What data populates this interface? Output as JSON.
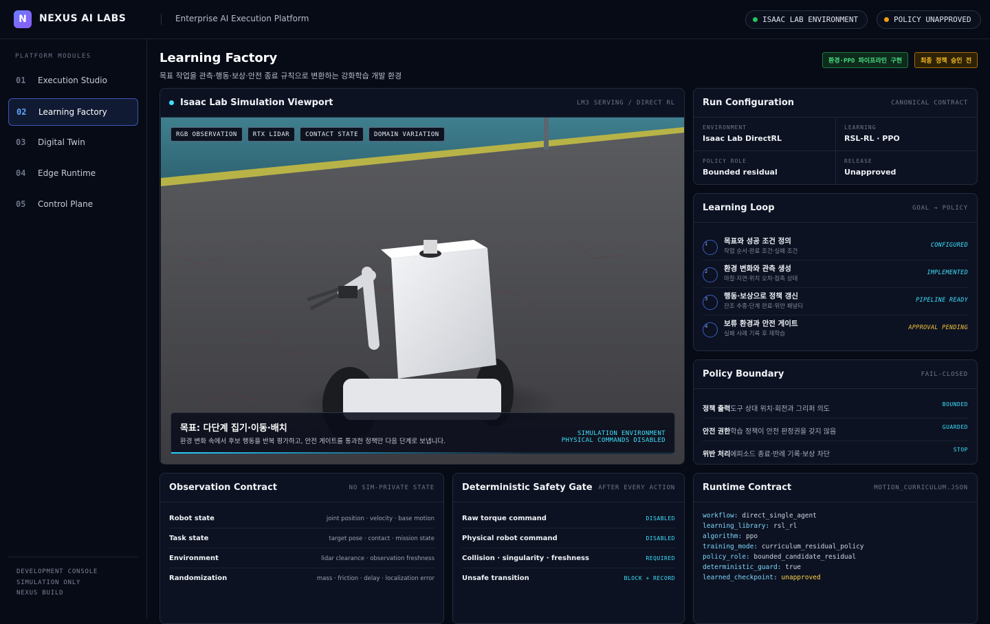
{
  "header": {
    "logo_letter": "N",
    "brand": "NEXUS AI LABS",
    "subtitle": "Enterprise AI Execution Platform",
    "status_pills": [
      {
        "label": "ISAAC LAB ENVIRONMENT",
        "color": "#22c55e"
      },
      {
        "label": "POLICY UNAPPROVED",
        "color": "#f59e0b"
      }
    ]
  },
  "sidebar": {
    "heading": "PLATFORM MODULES",
    "items": [
      {
        "num": "01",
        "label": "Execution Studio",
        "active": false
      },
      {
        "num": "02",
        "label": "Learning Factory",
        "active": true
      },
      {
        "num": "03",
        "label": "Digital Twin",
        "active": false
      },
      {
        "num": "04",
        "label": "Edge Runtime",
        "active": false
      },
      {
        "num": "05",
        "label": "Control Plane",
        "active": false
      }
    ],
    "footer": [
      "DEVELOPMENT CONSOLE",
      "SIMULATION ONLY",
      "NEXUS BUILD"
    ]
  },
  "page": {
    "title": "Learning Factory",
    "subtitle": "목표 작업을 관측·행동·보상·안전 종료 규칙으로 변환하는 강화학습 개발 환경",
    "badges": [
      {
        "label": "환경·PPO 파이프라인 구현",
        "color": "#22c55e"
      },
      {
        "label": "최종 정책 승인 전",
        "color": "#f59e0b"
      }
    ]
  },
  "viewport": {
    "title": "Isaac Lab Simulation Viewport",
    "meta": "LM3 SERVING / DIRECT RL",
    "tags": [
      "RGB OBSERVATION",
      "RTX LIDAR",
      "CONTACT STATE",
      "DOMAIN VARIATION"
    ],
    "goal_title": "목표: 다단계 집기·이동·배치",
    "goal_desc": "환경 변화 속에서 후보 행동을 반복 평가하고, 안전 게이트를 통과한 정책만 다음 단계로 보냅니다.",
    "goal_status_1": "SIMULATION ENVIRONMENT",
    "goal_status_2": "PHYSICAL COMMANDS DISABLED"
  },
  "run_config": {
    "title": "Run Configuration",
    "meta": "CANONICAL CONTRACT",
    "cells": [
      {
        "key": "ENVIRONMENT",
        "value": "Isaac Lab DirectRL"
      },
      {
        "key": "LEARNING",
        "value": "RSL-RL · PPO"
      },
      {
        "key": "POLICY ROLE",
        "value": "Bounded residual"
      },
      {
        "key": "RELEASE",
        "value": "Unapproved"
      }
    ]
  },
  "learning_loop": {
    "title": "Learning Loop",
    "meta": "GOAL → POLICY",
    "steps": [
      {
        "n": "1",
        "title": "목표와 성공 조건 정의",
        "desc": "작업 순서·완료 조건·실패 조건",
        "status": "CONFIGURED",
        "color": "#3ee0ff"
      },
      {
        "n": "2",
        "title": "환경 변화와 관측 생성",
        "desc": "마찰·지연·위치 오차·접촉 상태",
        "status": "IMPLEMENTED",
        "color": "#3ee0ff"
      },
      {
        "n": "3",
        "title": "행동·보상으로 정책 갱신",
        "desc": "잔조 추종·단계 완료·위반 패널티",
        "status": "PIPELINE READY",
        "color": "#3ee0ff"
      },
      {
        "n": "4",
        "title": "보류 환경과 안전 게이트",
        "desc": "실패 사례 기록 후 재학습",
        "status": "APPROVAL PENDING",
        "color": "#f5c542"
      }
    ]
  },
  "policy_boundary": {
    "title": "Policy Boundary",
    "meta": "FAIL-CLOSED",
    "rows": [
      {
        "label": "정책 출력",
        "desc": "도구 상대 위치·회전과 그리퍼 의도",
        "status": "BOUNDED"
      },
      {
        "label": "안전 권한",
        "desc": "학습 정책이 안전 판정권을 갖지 않음",
        "status": "GUARDED"
      },
      {
        "label": "위반 처리",
        "desc": "에피소드 종료·반례 기록·보상 차단",
        "status": "STOP"
      }
    ]
  },
  "observation": {
    "title": "Observation Contract",
    "meta": "NO SIM-PRIVATE STATE",
    "rows": [
      {
        "label": "Robot state",
        "value": "joint position · velocity · base motion"
      },
      {
        "label": "Task state",
        "value": "target pose · contact · mission state"
      },
      {
        "label": "Environment",
        "value": "lidar clearance · observation freshness"
      },
      {
        "label": "Randomization",
        "value": "mass · friction · delay · localization error"
      }
    ]
  },
  "safety_gate": {
    "title": "Deterministic Safety Gate",
    "meta": "AFTER EVERY ACTION",
    "rows": [
      {
        "label": "Raw torque command",
        "value": "DISABLED"
      },
      {
        "label": "Physical robot command",
        "value": "DISABLED"
      },
      {
        "label": "Collision · singularity · freshness",
        "value": "REQUIRED"
      },
      {
        "label": "Unsafe transition",
        "value": "BLOCK + RECORD"
      }
    ]
  },
  "runtime": {
    "title": "Runtime Contract",
    "meta": "MOTION_CURRICULUM.JSON",
    "lines": [
      {
        "key": "workflow:",
        "value": "direct_single_agent",
        "highlight": false
      },
      {
        "key": "learning_library:",
        "value": "rsl_rl",
        "highlight": false
      },
      {
        "key": "algorithm:",
        "value": "ppo",
        "highlight": false
      },
      {
        "key": "training_mode:",
        "value": "curriculum_residual_policy",
        "highlight": false
      },
      {
        "key": "policy_role:",
        "value": "bounded_candidate_residual",
        "highlight": false
      },
      {
        "key": "deterministic_guard:",
        "value": "true",
        "highlight": false
      },
      {
        "key": "learned_checkpoint:",
        "value": "unapproved",
        "highlight": true
      }
    ]
  }
}
